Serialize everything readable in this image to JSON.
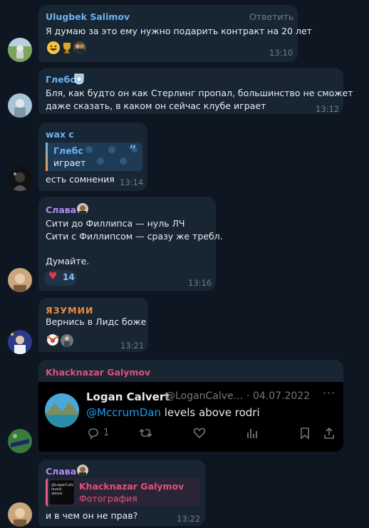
{
  "messages": [
    {
      "author": "Ulugbek Salimov",
      "author_color": "#6ab3f3",
      "reply_label": "Ответить",
      "text": "Я думаю за это ему нужно подарить контракт на 20 лет",
      "reactions": [
        "grinning-face",
        "trophy",
        "group-photo"
      ],
      "time": "13:10"
    },
    {
      "author": "Глебс",
      "author_color": "#6ab3f3",
      "badge": "club-shield-icon",
      "lines": [
        "Бля, как будто он как Стерлинг пропал, большинство не сможет",
        "даже сказать, в каком он сейчас клубе играет"
      ],
      "time": "13:12"
    },
    {
      "author": "wax c",
      "author_color": "#6ab3f3",
      "quote": {
        "author": "Глебс",
        "text": "играет"
      },
      "text": "есть сомнения",
      "time": "13:14"
    },
    {
      "author": "Слава",
      "author_color": "#b18cf3",
      "lines": [
        "Сити до Филлипса — нуль ЛЧ",
        "Сити с Филлипсом — сразу же требл.",
        "",
        "Думайте."
      ],
      "reaction": {
        "emoji": "heart",
        "count": "14"
      },
      "time": "13:16"
    },
    {
      "author": "ЯЗУМИИ",
      "author_color": "#f08a3c",
      "text": "Вернись в Лидс боже",
      "reactions": [
        "clown-face",
        "pointing-person"
      ],
      "time": "13:21"
    },
    {
      "author": "Khacknazar Galymov",
      "author_color": "#e2507d",
      "tweet": {
        "name": "Logan Calvert",
        "handle": "@LoganCalve...",
        "date": "04.07.2022",
        "mention": "@MccrumDan",
        "body": " levels above rodri",
        "replies": "1"
      }
    },
    {
      "author": "Слава",
      "author_color": "#b18cf3",
      "quote": {
        "author": "Khacknazar Galymov",
        "text": "Фотография",
        "thumb_text": "@LoganCalv levels above"
      },
      "text": "и в чем он не прав?",
      "time": "13:22"
    }
  ],
  "colors": {
    "background": "#0e1621",
    "bubble": "#182533",
    "time": "#6d7f8f",
    "link": "#6ab3f3"
  }
}
